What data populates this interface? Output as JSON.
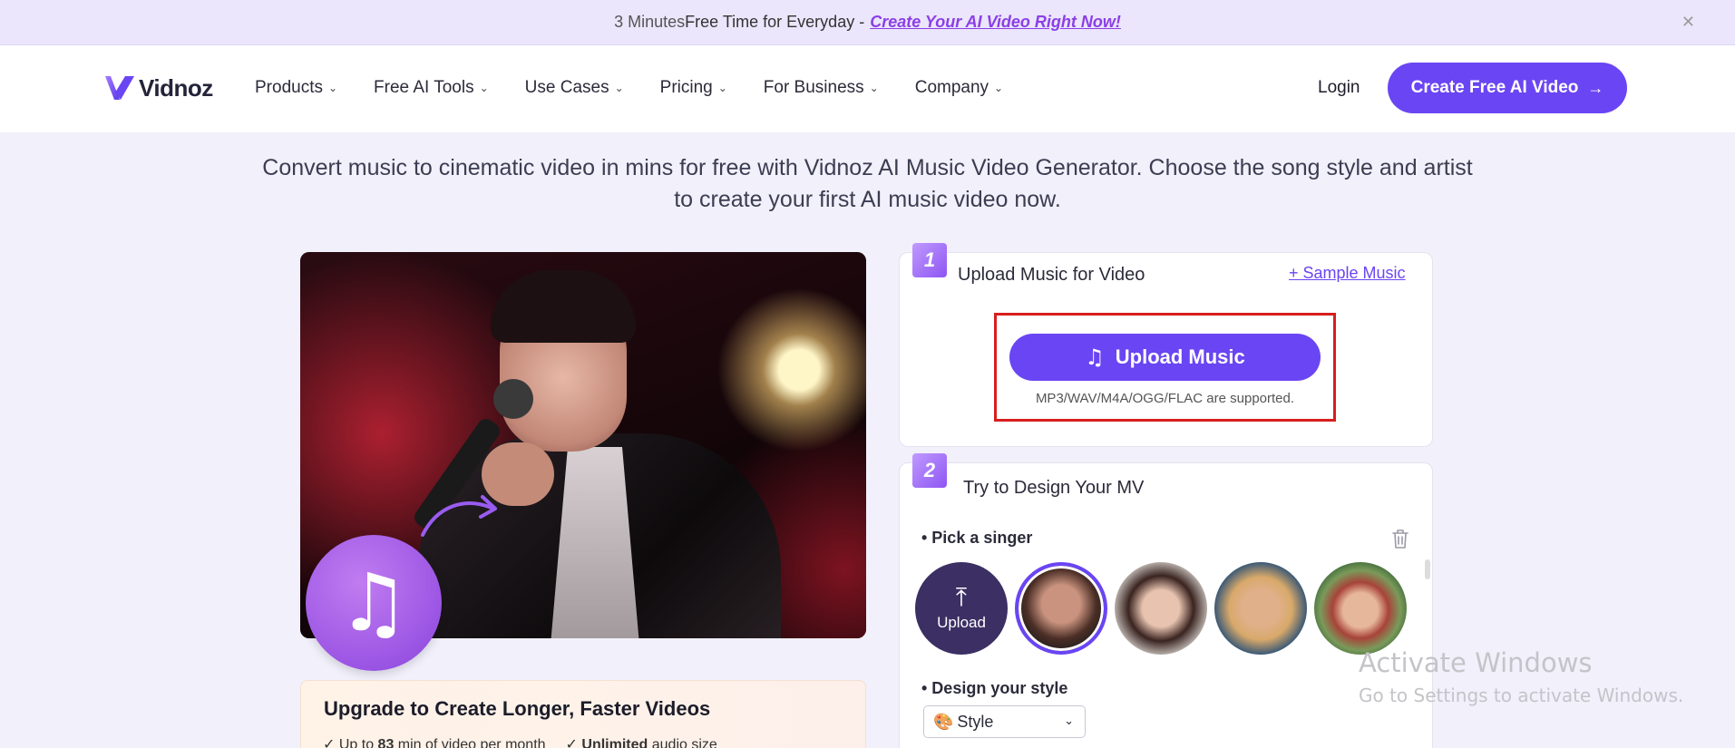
{
  "promo": {
    "text_start": "3 Minutes ",
    "text_free": "Free Time for Everyday - ",
    "link": "Create Your AI Video Right Now!",
    "close": "✕"
  },
  "header": {
    "logo_text": "Vidnoz",
    "nav": [
      "Products",
      "Free AI Tools",
      "Use Cases",
      "Pricing",
      "For Business",
      "Company"
    ],
    "login": "Login",
    "cta": "Create Free AI Video",
    "cta_arrow": "→"
  },
  "hero": {
    "description": "Convert music to cinematic video in mins for free with Vidnoz AI Music Video Generator. Choose the song style and artist to create your first AI music video now."
  },
  "upgrade": {
    "title": "Upgrade to Create Longer, Faster Videos",
    "feature1_pre": "✓ Up to ",
    "feature1_bold": "83",
    "feature1_post": " min of video per month",
    "feature2_pre": "✓ ",
    "feature2_bold": "Unlimited",
    "feature2_post": " audio size"
  },
  "step1": {
    "number": "1",
    "title": "Upload Music for Video",
    "sample_link": "+ Sample Music",
    "upload_button": "Upload Music",
    "formats": "MP3/WAV/M4A/OGG/FLAC are supported."
  },
  "step2": {
    "number": "2",
    "title": "Try to Design Your MV",
    "pick_singer": "• Pick a singer",
    "upload_avatar": "Upload",
    "design_style": "• Design your style",
    "style_value": "Style"
  },
  "watermark": {
    "line1": "Activate Windows",
    "line2": "Go to Settings to activate Windows."
  },
  "colors": {
    "accent": "#6a45f3",
    "highlight_box": "#d81e1e",
    "promo_link": "#8b3fe6"
  }
}
